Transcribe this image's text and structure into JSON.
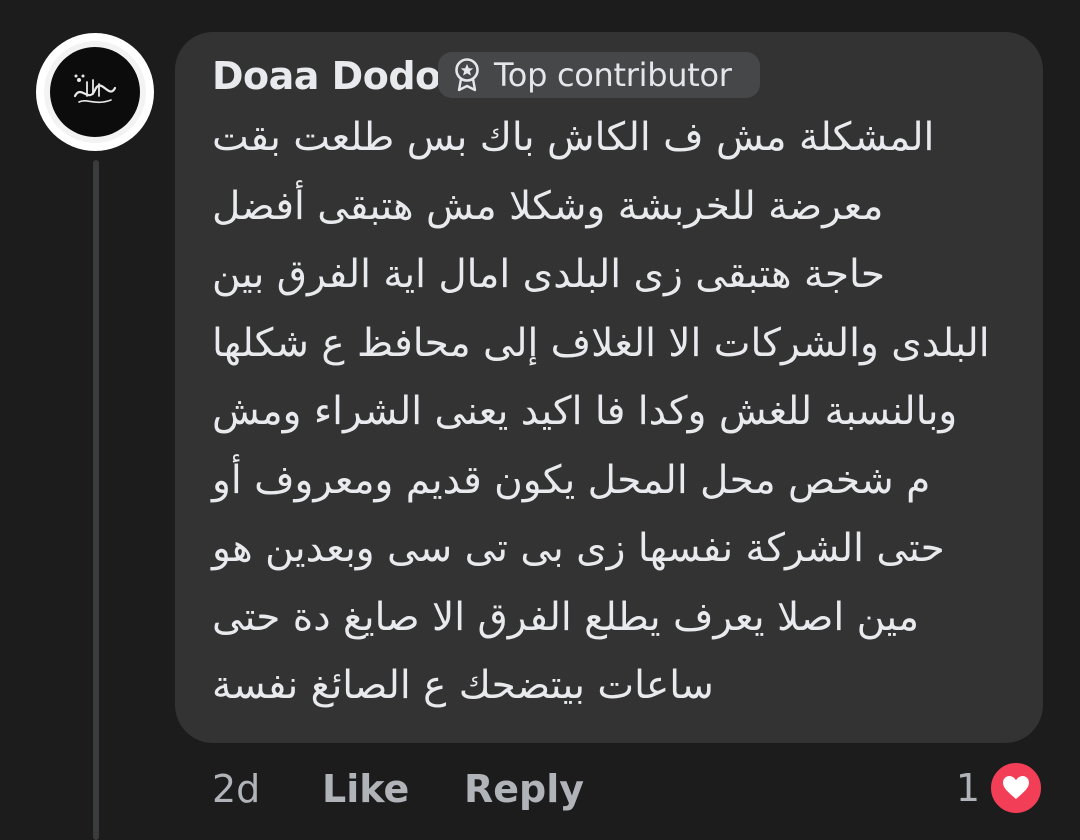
{
  "comment": {
    "author": "Doaa Dodo",
    "badge_label": "Top contributor",
    "avatar_icon": "calligraphy-avatar",
    "lines": [
      "المشكلة مش ف الكاش باك بس طلعت بقت",
      "معرضة للخربشة وشكلا مش هتبقى أفضل",
      "حاجة هتبقى زى البلدى امال اية الفرق بين",
      "البلدى والشركات الا الغلاف إلى محافظ ع شكلها",
      "وبالنسبة للغش وكدا فا اكيد يعنى الشراء ومش",
      "م شخص محل المحل يكون قديم ومعروف أو",
      "حتى الشركة نفسها زى بى تى سى وبعدين هو",
      "مين اصلا يعرف يطلع الفرق الا صايغ دة حتى",
      "ساعات بيتضحك ع الصائغ نفسة"
    ]
  },
  "actions": {
    "time": "2d",
    "like": "Like",
    "reply": "Reply"
  },
  "reactions": {
    "count": "1",
    "icon": "heart-icon"
  },
  "colors": {
    "background": "#1c1c1d",
    "bubble": "#333334",
    "badge_bg": "#464748",
    "heart": "#f33e58",
    "text_primary": "#e9eaed",
    "text_secondary": "#b0b3b8"
  }
}
